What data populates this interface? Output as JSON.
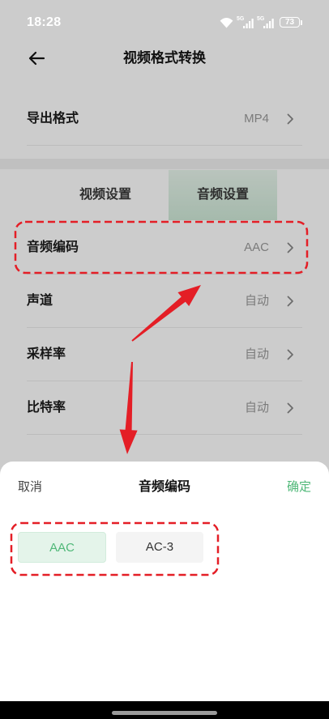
{
  "status_bar": {
    "time": "18:28",
    "network_label": "5G",
    "battery": "73"
  },
  "header": {
    "title": "视频格式转换"
  },
  "export_format": {
    "label": "导出格式",
    "value": "MP4"
  },
  "tabs": [
    {
      "label": "视频设置",
      "selected": false
    },
    {
      "label": "音频设置",
      "selected": true
    }
  ],
  "audio_settings": [
    {
      "label": "音频编码",
      "value": "AAC"
    },
    {
      "label": "声道",
      "value": "自动"
    },
    {
      "label": "采样率",
      "value": "自动"
    },
    {
      "label": "比特率",
      "value": "自动"
    }
  ],
  "sheet": {
    "cancel": "取消",
    "title": "音频编码",
    "confirm": "确定",
    "options": [
      {
        "label": "AAC",
        "selected": true
      },
      {
        "label": "AC-3",
        "selected": false
      }
    ]
  },
  "icons": {
    "back": "arrow-left-icon",
    "chevron": "chevron-right-icon",
    "wifi": "wifi-icon",
    "signal": "cellular-signal-icon",
    "battery": "battery-icon"
  },
  "colors": {
    "accent_green": "#4fb878",
    "annotation_red": "#e41e26"
  }
}
